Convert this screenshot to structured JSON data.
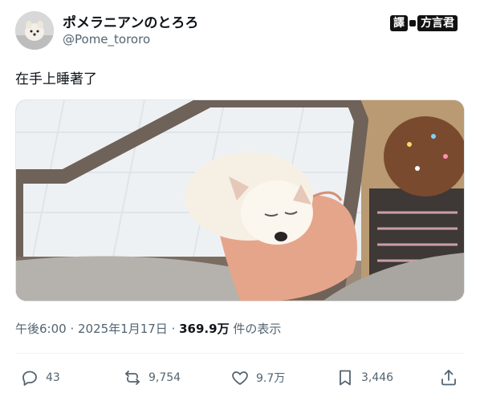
{
  "author": {
    "display_name": "ポメラニアンのとろろ",
    "handle": "@Pome_tororo"
  },
  "badge": {
    "left_text": "譯",
    "right_text": "方言君"
  },
  "tweet": {
    "text": "在手上睡著了",
    "media_alt": "photo-of-sleeping-pomeranian-puppy-in-hand"
  },
  "meta": {
    "time": "午後6:00",
    "sep1": " · ",
    "date": "2025年1月17日",
    "sep2": " · ",
    "views": "369.9万",
    "views_suffix": " 件の表示"
  },
  "actions": {
    "replies": "43",
    "reposts": "9,754",
    "likes": "9.7万",
    "bookmarks": "3,446"
  },
  "icons": {
    "reply": "reply-icon",
    "repost": "repost-icon",
    "like": "heart-icon",
    "bookmark": "bookmark-icon",
    "share": "share-icon"
  }
}
